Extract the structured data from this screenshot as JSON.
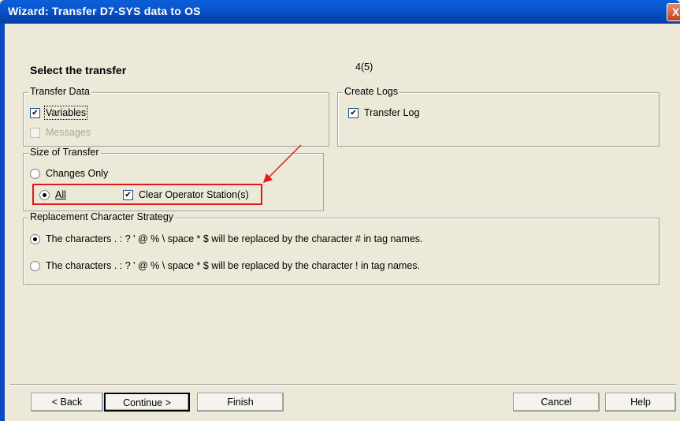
{
  "window": {
    "title": "Wizard: Transfer D7-SYS data to OS",
    "close_glyph": "X"
  },
  "step": {
    "heading": "Select the transfer",
    "counter": "4(5)"
  },
  "transfer_data": {
    "legend": "Transfer Data",
    "variables": {
      "label": "Variables",
      "checked": true
    },
    "messages": {
      "label": "Messages",
      "checked": false,
      "enabled": false
    }
  },
  "create_logs": {
    "legend": "Create Logs",
    "transfer_log": {
      "label": "Transfer Log",
      "checked": true
    }
  },
  "size_of_transfer": {
    "legend": "Size of Transfer",
    "changes_only": {
      "label": "Changes Only",
      "selected": false
    },
    "all": {
      "label": "All",
      "selected": true
    },
    "clear_os": {
      "label": "Clear Operator Station(s)",
      "checked": true
    }
  },
  "replacement": {
    "legend": "Replacement Character Strategy",
    "option1": {
      "label": "The characters . : ? ' @ % \\ space * $ will be replaced by the character # in tag names.",
      "selected": true
    },
    "option2": {
      "label": "The characters . : ? ' @ % \\ space * $ will be replaced by the character ! in tag names.",
      "selected": false
    }
  },
  "buttons": {
    "back": "< Back",
    "continue": "Continue >",
    "finish": "Finish",
    "cancel": "Cancel",
    "help": "Help"
  },
  "annotation_color": "#E41818"
}
